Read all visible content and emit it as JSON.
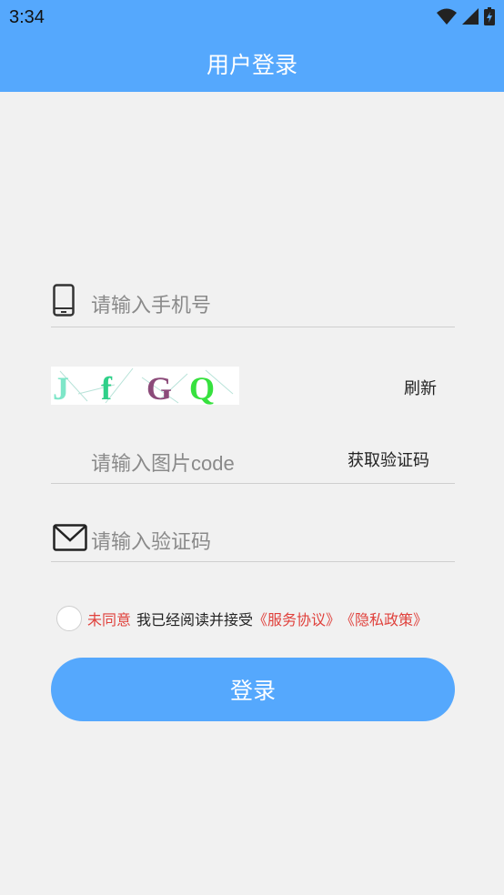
{
  "status": {
    "time": "3:34"
  },
  "header": {
    "title": "用户登录"
  },
  "form": {
    "phone_placeholder": "请输入手机号",
    "captcha_text": "JfGQ",
    "refresh_label": "刷新",
    "image_code_placeholder": "请输入图片code",
    "get_code_label": "获取验证码",
    "sms_code_placeholder": "请输入验证码"
  },
  "agreement": {
    "status": "未同意",
    "text": "我已经阅读并接受",
    "service_link": "《服务协议》",
    "privacy_link": "《隐私政策》"
  },
  "login_label": "登录",
  "colors": {
    "primary": "#55a8fd",
    "link": "#e0413c"
  }
}
